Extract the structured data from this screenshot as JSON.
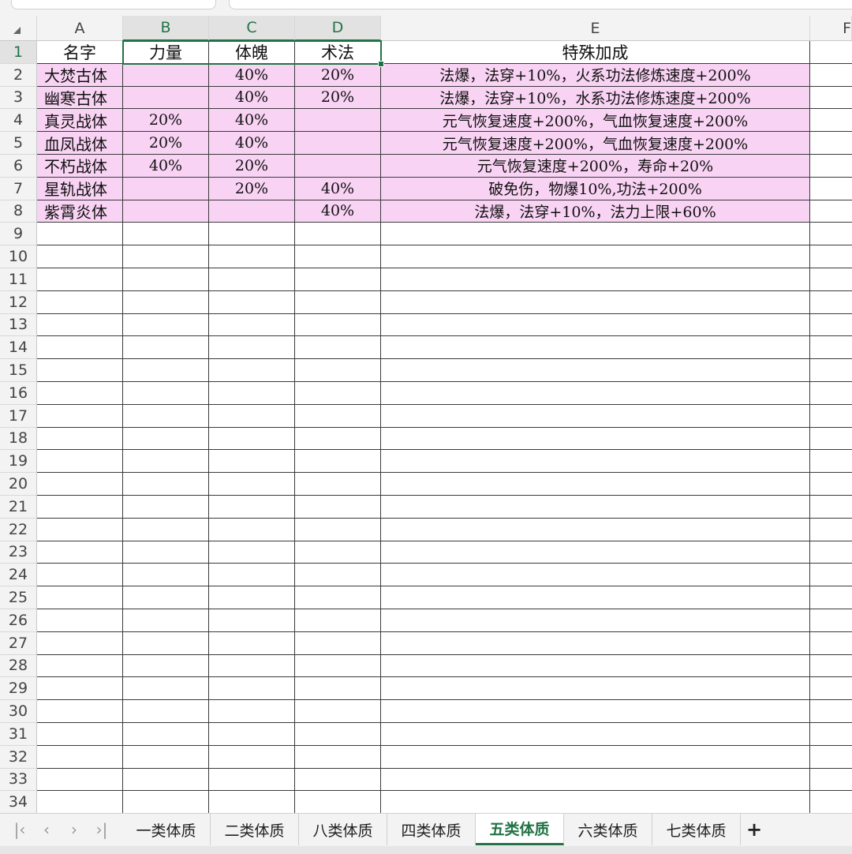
{
  "columns": [
    {
      "letter": "A"
    },
    {
      "letter": "B"
    },
    {
      "letter": "C"
    },
    {
      "letter": "D"
    },
    {
      "letter": "E"
    },
    {
      "letter": "F"
    }
  ],
  "header": [
    "名字",
    "力量",
    "体魄",
    "术法",
    "特殊加成"
  ],
  "rows": [
    [
      "大焚古体",
      "",
      "40%",
      "20%",
      "法爆，法穿+10%，火系功法修炼速度+200%"
    ],
    [
      "幽寒古体",
      "",
      "40%",
      "20%",
      "法爆，法穿+10%，水系功法修炼速度+200%"
    ],
    [
      "真灵战体",
      "20%",
      "40%",
      "",
      "元气恢复速度+200%，气血恢复速度+200%"
    ],
    [
      "血凤战体",
      "20%",
      "40%",
      "",
      "元气恢复速度+200%，气血恢复速度+200%"
    ],
    [
      "不朽战体",
      "40%",
      "20%",
      "",
      "元气恢复速度+200%，寿命+20%"
    ],
    [
      "星轨战体",
      "",
      "20%",
      "40%",
      "破免伤，物爆10%,功法+200%"
    ],
    [
      "紫霄炎体",
      "",
      "",
      "40%",
      "法爆，法穿+10%，法力上限+60%"
    ]
  ],
  "row_numbers": [
    "1",
    "2",
    "3",
    "4",
    "5",
    "6",
    "7",
    "8",
    "9",
    "10",
    "11",
    "12",
    "13",
    "14",
    "15",
    "16",
    "17",
    "18",
    "19",
    "20",
    "21",
    "22",
    "23",
    "24",
    "25",
    "26",
    "27",
    "28",
    "29",
    "30",
    "31",
    "32",
    "33",
    "34"
  ],
  "sheet_tabs": [
    "一类体质",
    "二类体质",
    "八类体质",
    "四类体质",
    "五类体质",
    "六类体质",
    "七类体质"
  ],
  "active_tab": "五类体质",
  "nav_icons": [
    "first-sheet-icon",
    "prev-sheet-icon",
    "next-sheet-icon",
    "last-sheet-icon"
  ],
  "add_sheet_icon": "plus-icon",
  "colors": {
    "highlight": "#f9d3f4",
    "accent": "#217346"
  }
}
